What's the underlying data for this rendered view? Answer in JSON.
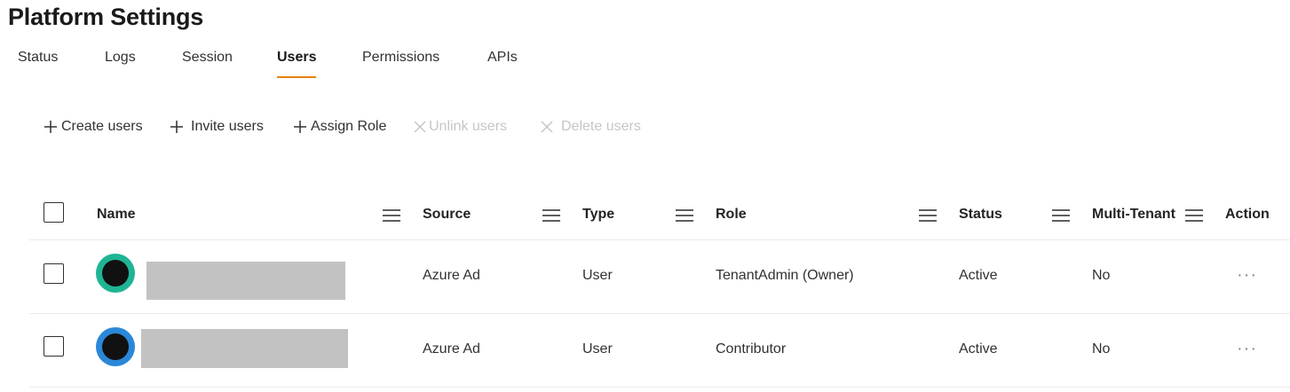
{
  "page": {
    "title": "Platform Settings"
  },
  "tabs": [
    {
      "label": "Status"
    },
    {
      "label": "Logs"
    },
    {
      "label": "Session"
    },
    {
      "label": "Users"
    },
    {
      "label": "Permissions"
    },
    {
      "label": "APIs"
    }
  ],
  "active_tab": "Users",
  "toolbar": {
    "create_users": "Create users",
    "invite_users": "Invite users",
    "assign_role": "Assign Role",
    "unlink_users": "Unlink users",
    "delete_users": "Delete users"
  },
  "table": {
    "columns": {
      "name": "Name",
      "source": "Source",
      "type": "Type",
      "role": "Role",
      "status": "Status",
      "multi_tenant": "Multi-Tenant",
      "action": "Action"
    },
    "rows": [
      {
        "source": "Azure Ad",
        "type": "User",
        "role": "TenantAdmin (Owner)",
        "status": "Active",
        "multi_tenant": "No",
        "action": "···",
        "avatar_color": "#1fb594"
      },
      {
        "source": "Azure Ad",
        "type": "User",
        "role": "Contributor",
        "status": "Active",
        "multi_tenant": "No",
        "action": "···",
        "avatar_color": "#2b88d8"
      }
    ]
  },
  "colors": {
    "accent": "#e8820c",
    "disabled_text": "#c8c6c4",
    "redaction": "#c2c2c2"
  }
}
